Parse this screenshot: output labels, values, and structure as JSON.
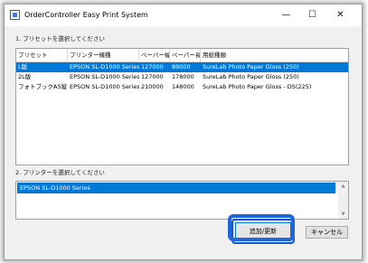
{
  "window": {
    "title": "OrderController Easy Print System",
    "minimize_glyph": "—",
    "maximize_glyph": "☐",
    "close_glyph": "✕"
  },
  "section1": {
    "label": "1. プリセットを選択してください"
  },
  "table": {
    "columns": [
      "プリセット",
      "プリンター機種",
      "ペーパー幅",
      "ペーパー長",
      "用紙種類"
    ],
    "rows": [
      [
        "L版",
        "EPSON SL-D1000 Series",
        "127000",
        "89000",
        "SureLab Photo Paper Gloss (250)"
      ],
      [
        "2L版",
        "EPSON SL-D1000 Series",
        "127000",
        "178000",
        "SureLab Photo Paper Gloss (250)"
      ],
      [
        "フォトブックA5縦",
        "EPSON SL-D1000 Series",
        "210000",
        "148000",
        "SureLab Photo Paper Gloss - DS(225)"
      ]
    ],
    "selected_row": 0
  },
  "section2": {
    "label": "2. プリンターを選択してください",
    "printers": [
      "EPSON SL-D1000 Series"
    ]
  },
  "buttons": {
    "ok_label": "追加/更新",
    "cancel_label": "キャンセル"
  },
  "colors": {
    "selection": "#0078d7",
    "highlight": "#1f66dd"
  }
}
